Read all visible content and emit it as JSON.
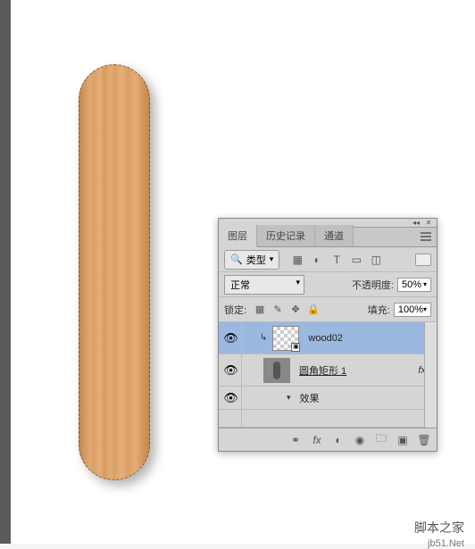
{
  "tabs": {
    "layers": "图层",
    "history": "历史记录",
    "channels": "通道"
  },
  "filter": {
    "kind_label": "类型"
  },
  "blend": {
    "mode": "正常",
    "opacity_label": "不透明度:",
    "opacity_value": "50%"
  },
  "lock": {
    "label": "锁定:",
    "fill_label": "填充:",
    "fill_value": "100%"
  },
  "layers": [
    {
      "name": "wood02",
      "selected": true,
      "clipped": true
    },
    {
      "name": "圆角矩形 1",
      "fx": "fx"
    },
    {
      "effects_label": "效果"
    }
  ],
  "watermark": {
    "main": "脚本之家",
    "sub": "jb51.Net"
  }
}
